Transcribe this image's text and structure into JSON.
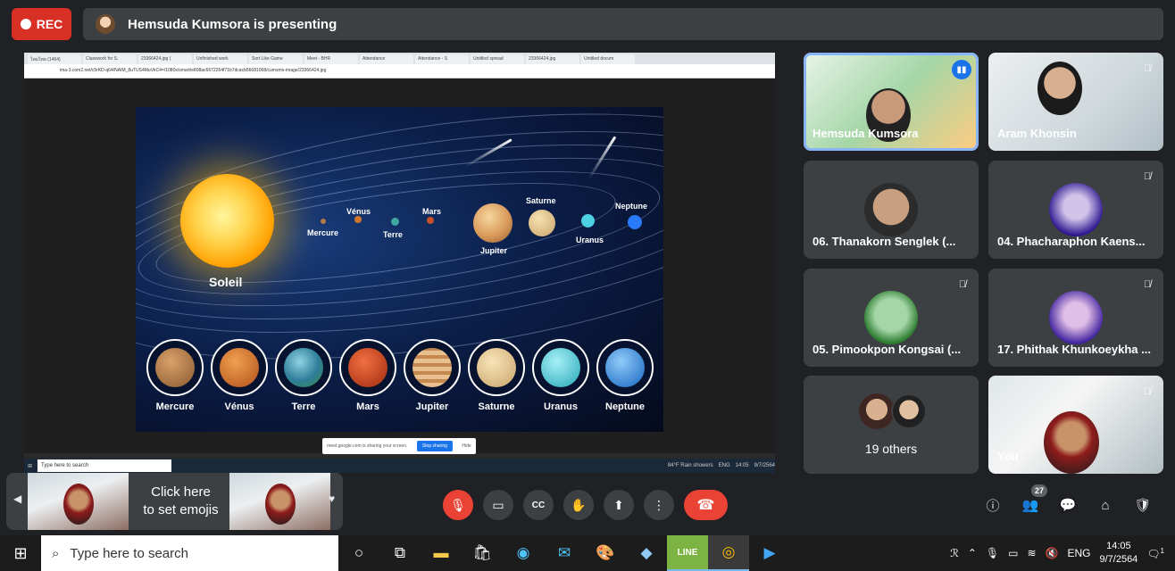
{
  "meet": {
    "rec_label": "REC",
    "presenter_text": "Hemsuda Kumsora is presenting",
    "accent_red": "#ea4335",
    "accent_blue": "#1a73e8"
  },
  "shared_screen": {
    "browser_tabs": [
      "ไหมไทย (1464)",
      "Classwork for S.",
      "23366424.jpg (",
      "Unfinished work",
      "Sort Like Game",
      "Meet - BHR",
      "Attendance",
      "Attendance - S",
      "Untitled spread",
      "23366424.jpg",
      "Untitled docum"
    ],
    "address": "ima-3.com2.net/c5rKD-q64/NAIM_8uTUS4MuVkC4=/1080x/smart/e808ac6672264f71b7dcacb56681068/cumsmo-image/23366424.jpg",
    "slide": {
      "sun_label": "Soleil",
      "orbit_labels": [
        "Mercure",
        "Vénus",
        "Terre",
        "Mars",
        "Jupiter",
        "Saturne",
        "Uranus",
        "Neptune"
      ],
      "planet_names": [
        "Mercure",
        "Vénus",
        "Terre",
        "Mars",
        "Jupiter",
        "Saturne",
        "Uranus",
        "Neptune"
      ]
    },
    "share_notice": "meet.google.com is sharing your screen.",
    "stop_sharing": "Stop sharing",
    "hide": "Hide",
    "taskbar_search": "Type here to search",
    "weather": "84°F Rain showers",
    "lang": "ENG",
    "time": "14:05",
    "date": "9/7/2564"
  },
  "participants": [
    {
      "name": "Hemsuda Kumsora",
      "state": "speaking"
    },
    {
      "name": "Aram Khonsin",
      "state": "muted"
    },
    {
      "name": "06. Thanakorn Senglek (...",
      "state": "none"
    },
    {
      "name": "04. Phacharaphon Kaens...",
      "state": "muted"
    },
    {
      "name": "05. Pimookpon Kongsai (...",
      "state": "muted"
    },
    {
      "name": "17. Phithak Khunkoeykha ...",
      "state": "muted"
    },
    {
      "name": "19 others",
      "state": "none"
    },
    {
      "name": "You",
      "state": "muted"
    }
  ],
  "reaction_panel": {
    "line1": "Click here",
    "line2": "to set emojis"
  },
  "controls": {
    "people_count": "27"
  },
  "taskbar": {
    "search_placeholder": "Type here to search",
    "lang": "ENG",
    "time": "14:05",
    "date": "9/7/2564",
    "notification_count": "1"
  }
}
